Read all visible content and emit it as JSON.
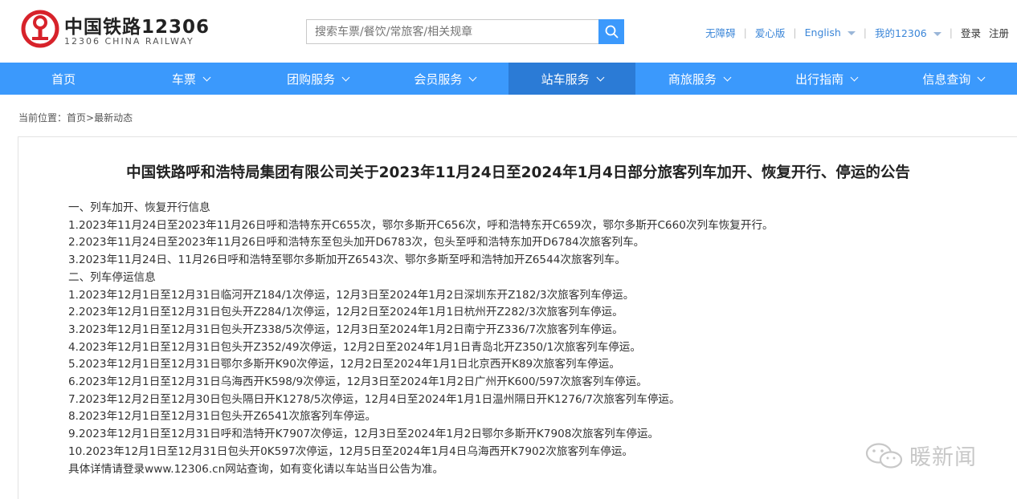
{
  "header": {
    "brand_cn": "中国铁路12306",
    "brand_en": "12306 CHINA RAILWAY",
    "search_placeholder": "搜索车票/餐饮/常旅客/相关规章",
    "links": {
      "accessibility": "无障碍",
      "care": "爱心版",
      "english": "English",
      "my12306": "我的12306",
      "login": "登录",
      "register": "注册"
    }
  },
  "nav": {
    "items": [
      {
        "label": "首页"
      },
      {
        "label": "车票"
      },
      {
        "label": "团购服务"
      },
      {
        "label": "会员服务"
      },
      {
        "label": "站车服务"
      },
      {
        "label": "商旅服务"
      },
      {
        "label": "出行指南"
      },
      {
        "label": "信息查询"
      }
    ],
    "active_index": 4
  },
  "breadcrumb": {
    "prefix": "当前位置：",
    "home": "首页",
    "separator": ">",
    "current": "最新动态"
  },
  "article": {
    "title": "中国铁路呼和浩特局集团有限公司关于2023年11月24日至2024年1月4日部分旅客列车加开、恢复开行、停运的公告",
    "lines": [
      "一、列车加开、恢复开行信息",
      "1.2023年11月24日至2023年11月26日呼和浩特东开C655次，鄂尔多斯开C656次，呼和浩特东开C659次，鄂尔多斯开C660次列车恢复开行。",
      "2.2023年11月24日至2023年11月26日呼和浩特东至包头加开D6783次，包头至呼和浩特东加开D6784次旅客列车。",
      "3.2023年11月24日、11月26日呼和浩特至鄂尔多斯加开Z6543次、鄂尔多斯至呼和浩特加开Z6544次旅客列车。",
      "二、列车停运信息",
      "1.2023年12月1日至12月31日临河开Z184/1次停运，12月3日至2024年1月2日深圳东开Z182/3次旅客列车停运。",
      "2.2023年12月1日至12月31日包头开Z284/1次停运，12月2日至2024年1月1日杭州开Z282/3次旅客列车停运。",
      "3.2023年12月1日至12月31日包头开Z338/5次停运，12月3日至2024年1月2日南宁开Z336/7次旅客列车停运。",
      "4.2023年12月1日至12月31日包头开Z352/49次停运，12月2日至2024年1月1日青岛北开Z350/1次旅客列车停运。",
      "5.2023年12月1日至12月31日鄂尔多斯开K90次停运，12月2日至2024年1月1日北京西开K89次旅客列车停运。",
      "6.2023年12月1日至12月31日乌海西开K598/9次停运，12月3日至2024年1月2日广州开K600/597次旅客列车停运。",
      "7.2023年12月2日至12月30日包头隔日开K1278/5次停运，12月4日至2024年1月1日温州隔日开K1276/7次旅客列车停运。",
      "8.2023年12月1日至12月31日包头开Z6541次旅客列车停运。",
      "9.2023年12月1日至12月31日呼和浩特开K7907次停运，12月3日至2024年1月2日鄂尔多斯开K7908次旅客列车停运。",
      "10.2023年12月1日至12月31日包头开0K597次停运，12月5日至2024年1月4日乌海西开K7902次旅客列车停运。",
      "具体详情请登录www.12306.cn网站查询，如有变化请以车站当日公告为准。"
    ]
  },
  "watermark": {
    "text": "暖新闻"
  },
  "colors": {
    "nav_bg": "#3b99fc",
    "nav_active_bg": "#2b7bd6",
    "logo_red": "#d7222a",
    "link_blue": "#3b86d8"
  }
}
